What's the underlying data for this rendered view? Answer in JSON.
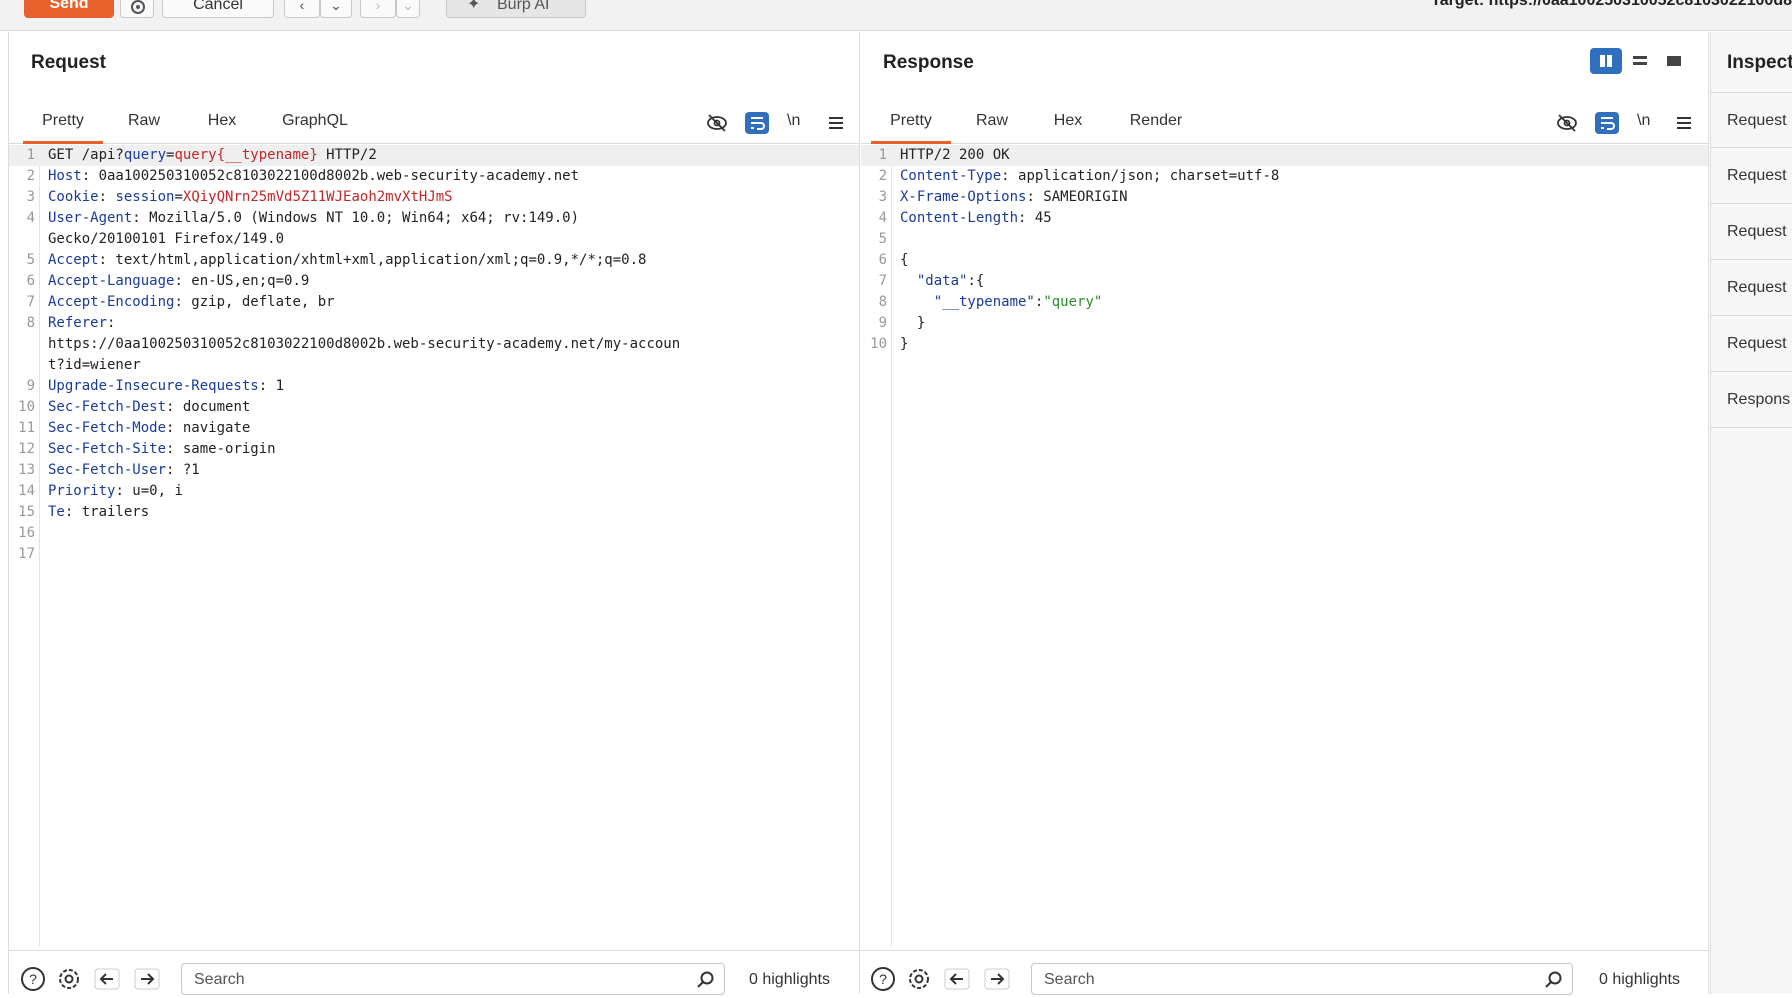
{
  "toolbar": {
    "send_label": "Send",
    "cancel_label": "Cancel",
    "burp_ai_label": "Burp AI",
    "target_label": "Target: https://0aa100250310052c8103022100d8"
  },
  "request": {
    "title": "Request",
    "tabs": [
      "Pretty",
      "Raw",
      "Hex",
      "GraphQL"
    ],
    "active_tab": "Pretty",
    "lines": [
      {
        "n": "1",
        "parts": [
          [
            "v",
            "GET /api?"
          ],
          [
            "k",
            "query"
          ],
          [
            "v",
            "="
          ],
          [
            "r",
            "query{__typename}"
          ],
          [
            "v",
            " HTTP/2"
          ]
        ]
      },
      {
        "n": "2",
        "parts": [
          [
            "k",
            "Host"
          ],
          [
            "v",
            ": 0aa100250310052c8103022100d8002b.web-security-academy.net"
          ]
        ]
      },
      {
        "n": "3",
        "parts": [
          [
            "k",
            "Cookie"
          ],
          [
            "v",
            ": "
          ],
          [
            "k",
            "session"
          ],
          [
            "v",
            "="
          ],
          [
            "r",
            "XQiyQNrn25mVd5Z11WJEaoh2mvXtHJmS"
          ]
        ]
      },
      {
        "n": "4",
        "parts": [
          [
            "k",
            "User-Agent"
          ],
          [
            "v",
            ": Mozilla/5.0 (Windows NT 10.0; Win64; x64; rv:149.0)"
          ]
        ]
      },
      {
        "n": "",
        "parts": [
          [
            "v",
            "Gecko/20100101 Firefox/149.0"
          ]
        ]
      },
      {
        "n": "5",
        "parts": [
          [
            "k",
            "Accept"
          ],
          [
            "v",
            ": text/html,application/xhtml+xml,application/xml;q=0.9,*/*;q=0.8"
          ]
        ]
      },
      {
        "n": "6",
        "parts": [
          [
            "k",
            "Accept-Language"
          ],
          [
            "v",
            ": en-US,en;q=0.9"
          ]
        ]
      },
      {
        "n": "7",
        "parts": [
          [
            "k",
            "Accept-Encoding"
          ],
          [
            "v",
            ": gzip, deflate, br"
          ]
        ]
      },
      {
        "n": "8",
        "parts": [
          [
            "k",
            "Referer"
          ],
          [
            "v",
            ":"
          ]
        ]
      },
      {
        "n": "",
        "parts": [
          [
            "v",
            "https://0aa100250310052c8103022100d8002b.web-security-academy.net/my-accoun"
          ]
        ]
      },
      {
        "n": "",
        "parts": [
          [
            "v",
            "t?id=wiener"
          ]
        ]
      },
      {
        "n": "9",
        "parts": [
          [
            "k",
            "Upgrade-Insecure-Requests"
          ],
          [
            "v",
            ": 1"
          ]
        ]
      },
      {
        "n": "10",
        "parts": [
          [
            "k",
            "Sec-Fetch-Dest"
          ],
          [
            "v",
            ": document"
          ]
        ]
      },
      {
        "n": "11",
        "parts": [
          [
            "k",
            "Sec-Fetch-Mode"
          ],
          [
            "v",
            ": navigate"
          ]
        ]
      },
      {
        "n": "12",
        "parts": [
          [
            "k",
            "Sec-Fetch-Site"
          ],
          [
            "v",
            ": same-origin"
          ]
        ]
      },
      {
        "n": "13",
        "parts": [
          [
            "k",
            "Sec-Fetch-User"
          ],
          [
            "v",
            ": ?1"
          ]
        ]
      },
      {
        "n": "14",
        "parts": [
          [
            "k",
            "Priority"
          ],
          [
            "v",
            ": u=0, i"
          ]
        ]
      },
      {
        "n": "15",
        "parts": [
          [
            "k",
            "Te"
          ],
          [
            "v",
            ": trailers"
          ]
        ]
      },
      {
        "n": "16",
        "parts": []
      },
      {
        "n": "17",
        "parts": []
      }
    ],
    "search_placeholder": "Search",
    "highlights": "0 highlights"
  },
  "response": {
    "title": "Response",
    "tabs": [
      "Pretty",
      "Raw",
      "Hex",
      "Render"
    ],
    "active_tab": "Pretty",
    "lines": [
      {
        "n": "1",
        "parts": [
          [
            "v",
            "HTTP/2 200 OK"
          ]
        ]
      },
      {
        "n": "2",
        "parts": [
          [
            "k",
            "Content-Type"
          ],
          [
            "v",
            ": application/json; charset=utf-8"
          ]
        ]
      },
      {
        "n": "3",
        "parts": [
          [
            "k",
            "X-Frame-Options"
          ],
          [
            "v",
            ": SAMEORIGIN"
          ]
        ]
      },
      {
        "n": "4",
        "parts": [
          [
            "k",
            "Content-Length"
          ],
          [
            "v",
            ": 45"
          ]
        ]
      },
      {
        "n": "5",
        "parts": []
      },
      {
        "n": "6",
        "parts": [
          [
            "v",
            "{"
          ]
        ]
      },
      {
        "n": "7",
        "parts": [
          [
            "v",
            "  "
          ],
          [
            "k",
            "\"data\""
          ],
          [
            "v",
            ":{"
          ]
        ]
      },
      {
        "n": "8",
        "parts": [
          [
            "v",
            "    "
          ],
          [
            "k",
            "\"__typename\""
          ],
          [
            "v",
            ":"
          ],
          [
            "g",
            "\"query\""
          ]
        ]
      },
      {
        "n": "9",
        "parts": [
          [
            "v",
            "  }"
          ]
        ]
      },
      {
        "n": "10",
        "parts": [
          [
            "v",
            "}"
          ]
        ]
      }
    ],
    "search_placeholder": "Search",
    "highlights": "0 highlights"
  },
  "inspector": {
    "title": "Inspect",
    "items": [
      "Request",
      "Request",
      "Request",
      "Request",
      "Request",
      "Respons"
    ]
  },
  "colors": {
    "accent": "#e8602c",
    "blue": "#2f6fbd",
    "key": "#1a3b9c",
    "red": "#c22727",
    "green": "#2e8b2e"
  }
}
